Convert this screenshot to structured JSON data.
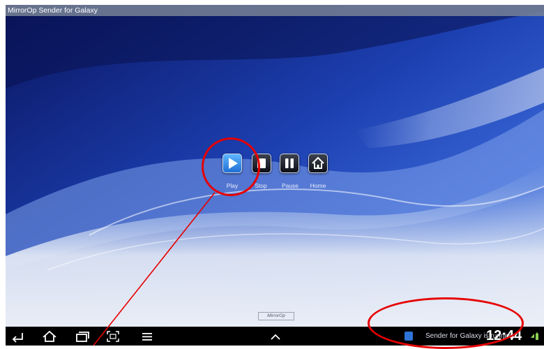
{
  "window": {
    "title": "MirrorOp Sender for Galaxy"
  },
  "controls": [
    {
      "id": "play",
      "label": "Play",
      "icon": "play-icon"
    },
    {
      "id": "stop",
      "label": "Stop",
      "icon": "stop-icon"
    },
    {
      "id": "pause",
      "label": "Pause",
      "icon": "pause-icon"
    },
    {
      "id": "home",
      "label": "Home",
      "icon": "home-icon"
    }
  ],
  "watermark": {
    "text": "MirrorOp"
  },
  "navbar": {
    "buttons": [
      "back-icon",
      "home-nav-icon",
      "recent-apps-icon",
      "screenshot-icon",
      "menu-icon",
      "chevron-up-icon"
    ]
  },
  "status": {
    "notification": "Sender for Galaxy is running",
    "clock": "12:44"
  },
  "colors": {
    "accent": "#2d74d6",
    "annotation": "#e60000",
    "navbar": "#000000"
  }
}
